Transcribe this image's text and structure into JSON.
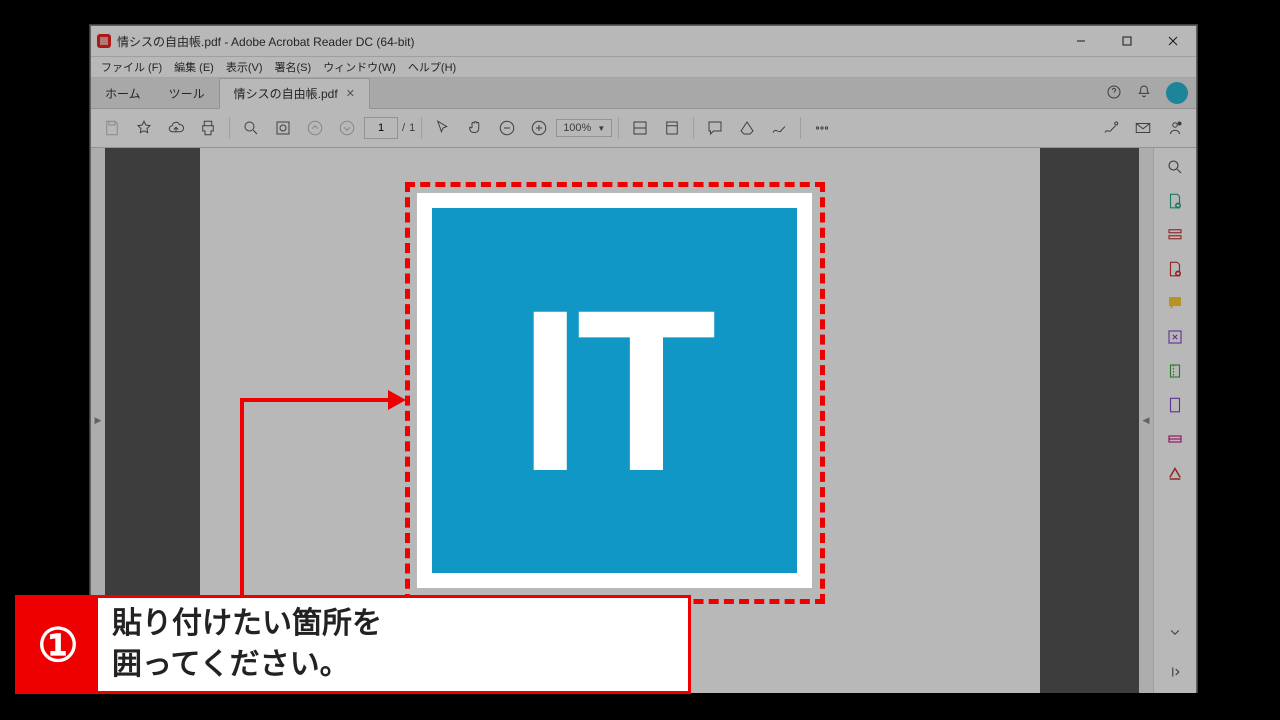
{
  "window": {
    "title": "情シスの自由帳.pdf - Adobe Acrobat Reader DC (64-bit)"
  },
  "menu": {
    "items": [
      "ファイル (F)",
      "編集 (E)",
      "表示(V)",
      "署名(S)",
      "ウィンドウ(W)",
      "ヘルプ(H)"
    ]
  },
  "tabs": {
    "home": "ホーム",
    "tools": "ツール",
    "active": "情シスの自由帳.pdf"
  },
  "toolbar": {
    "page_current": "1",
    "page_sep": "/",
    "page_total": "1",
    "zoom": "100%"
  },
  "document": {
    "logo_text": "IT"
  },
  "annotation": {
    "number": "①",
    "line1": "貼り付けたい箇所を",
    "line2": "囲ってください。"
  }
}
